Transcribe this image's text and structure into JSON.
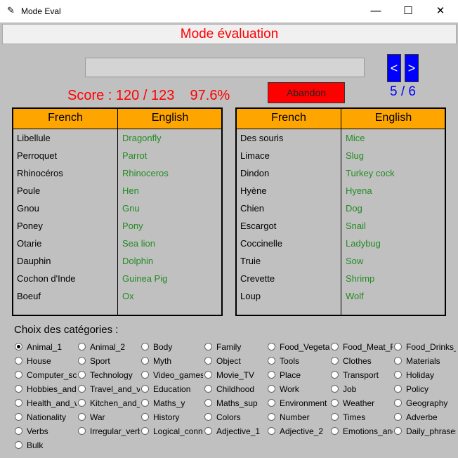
{
  "window": {
    "title": "Mode Eval",
    "minimize": "—",
    "maximize": "☐",
    "close": "✕"
  },
  "header": "Mode évaluation",
  "answer_input": {
    "value": ""
  },
  "nav": {
    "prev": "<",
    "next": ">",
    "page": "5 / 6"
  },
  "score": "Score : 120 / 123    97.6%",
  "abandon": "Abandon",
  "tables": [
    {
      "headers": [
        "French",
        "English"
      ],
      "rows": [
        [
          "Libellule",
          "Dragonfly"
        ],
        [
          "Perroquet",
          "Parrot"
        ],
        [
          "Rhinocéros",
          "Rhinoceros"
        ],
        [
          "Poule",
          "Hen"
        ],
        [
          "Gnou",
          "Gnu"
        ],
        [
          "Poney",
          "Pony"
        ],
        [
          "Otarie",
          "Sea lion"
        ],
        [
          "Dauphin",
          "Dolphin"
        ],
        [
          "Cochon d'Inde",
          "Guinea Pig"
        ],
        [
          "Boeuf",
          "Ox"
        ]
      ]
    },
    {
      "headers": [
        "French",
        "English"
      ],
      "rows": [
        [
          "Des souris",
          "Mice"
        ],
        [
          "Limace",
          "Slug"
        ],
        [
          "Dindon",
          "Turkey cock"
        ],
        [
          "Hyène",
          "Hyena"
        ],
        [
          "Chien",
          "Dog"
        ],
        [
          "Escargot",
          "Snail"
        ],
        [
          "Coccinelle",
          "Ladybug"
        ],
        [
          "Truie",
          "Sow"
        ],
        [
          "Crevette",
          "Shrimp"
        ],
        [
          "Loup",
          "Wolf"
        ]
      ]
    }
  ],
  "categories_label": "Choix des catégories :",
  "selected_category": "Animal_1",
  "categories": [
    [
      "Animal_1",
      "Animal_2",
      "Body",
      "Family",
      "Food_Vegetables",
      "Food_Meat_Fish",
      "Food_Drinks_Other"
    ],
    [
      "House",
      "Sport",
      "Myth",
      "Object",
      "Tools",
      "Clothes",
      "Materials"
    ],
    [
      "Computer_science",
      "Technology",
      "Video_games",
      "Movie_TV",
      "Place",
      "Transport",
      "Holiday"
    ],
    [
      "Hobbies_and_leisure",
      "Travel_and_vacation",
      "Education",
      "Childhood",
      "Work",
      "Job",
      "Policy"
    ],
    [
      "Health_and_wellness",
      "Kitchen_and_cooking",
      "Maths_y",
      "Maths_sup",
      "Environment",
      "Weather",
      "Geography"
    ],
    [
      "Nationality",
      "War",
      "History",
      "Colors",
      "Number",
      "Times",
      "Adverbe"
    ],
    [
      "Verbs",
      "Irregular_verbs",
      "Logical_connectors",
      "Adjective_1",
      "Adjective_2",
      "Emotions_and_feelings",
      "Daily_phrases"
    ],
    [
      "Bulk"
    ]
  ]
}
